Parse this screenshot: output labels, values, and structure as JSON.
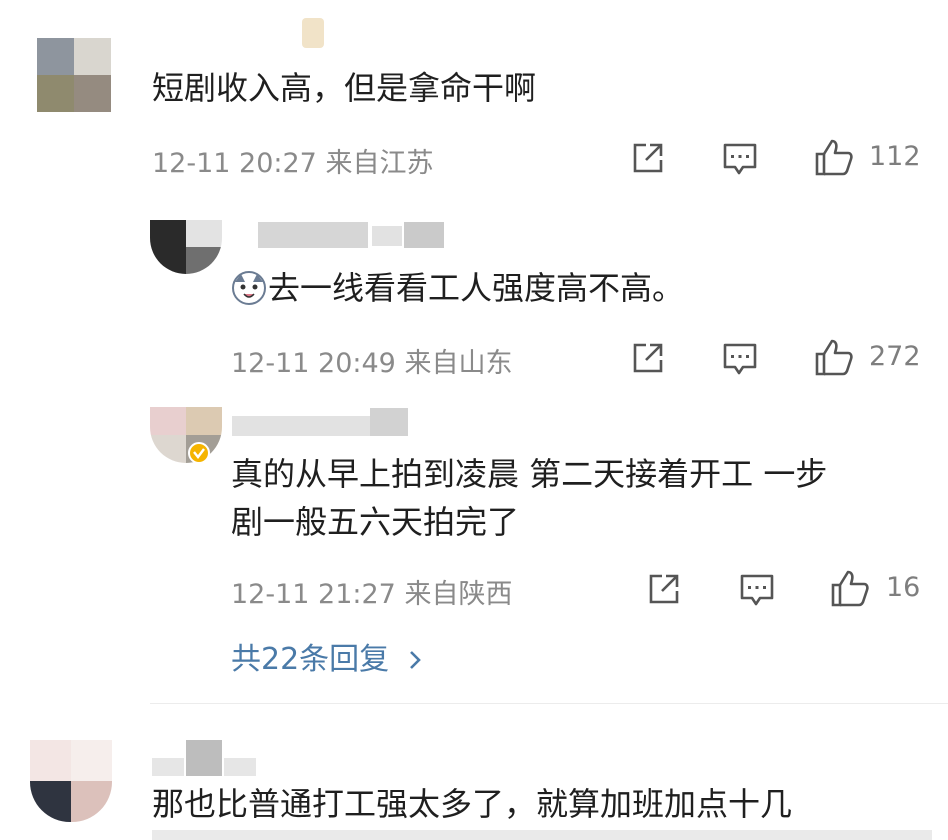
{
  "comments": [
    {
      "text": "短剧收入高，但是拿命干啊",
      "time": "12-11 20:27",
      "location": "来自江苏",
      "likes": "112"
    }
  ],
  "replies": [
    {
      "text": "去一线看看工人强度高不高。",
      "time": "12-11 20:49",
      "location": "来自山东",
      "likes": "272"
    },
    {
      "text_line1": "真的从早上拍到凌晨 第二天接着开工 一步",
      "text_line2": "剧一般五六天拍完了",
      "time": "12-11 21:27",
      "location": "来自陕西",
      "likes": "16"
    }
  ],
  "more_replies": "共22条回复",
  "next_comment": {
    "text": "那也比普通打工强太多了，就算加班加点十几"
  },
  "icons": {
    "share": "share-icon",
    "comment": "comment-icon",
    "like": "thumbs-up-icon",
    "chevron": "chevron-right-icon",
    "verified": "verified-badge-icon",
    "emoji": "dog-emoji-icon"
  },
  "colors": {
    "link": "#4a7aa8",
    "meta": "#8a8a8a",
    "verified": "#f5b400"
  }
}
